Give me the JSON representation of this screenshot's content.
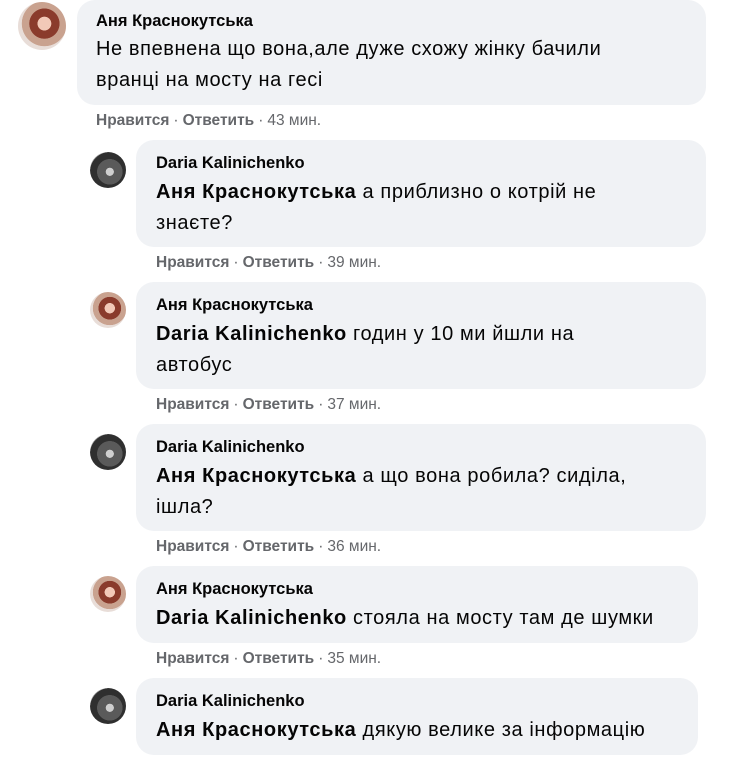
{
  "comments": [
    {
      "author": "Аня Краснокутська",
      "avatar": "aya",
      "mention": "",
      "text": "Не впевнена що вона,але дуже схожу жінку бачили вранці на мосту на гесі",
      "line1": "Не впевнена що вона,але дуже схожу жінку бачили",
      "line2": "вранці на мосту на гесі",
      "like": "Нравится",
      "reply": "Ответить",
      "time": "43 мин."
    },
    {
      "author": "Daria Kalinichenko",
      "avatar": "daria",
      "mention": "Аня Краснокутська",
      "line1": " а приблизно о котрій не",
      "line2": "знаєте?",
      "like": "Нравится",
      "reply": "Ответить",
      "time": "39 мин."
    },
    {
      "author": "Аня Краснокутська",
      "avatar": "aya",
      "mention": "Daria Kalinichenko",
      "line1": " годин у 10 ми йшли на",
      "line2": "автобус",
      "like": "Нравится",
      "reply": "Ответить",
      "time": "37 мин."
    },
    {
      "author": "Daria Kalinichenko",
      "avatar": "daria",
      "mention": "Аня Краснокутська",
      "line1": " а що вона робила? сиділа,",
      "line2": "ішла?",
      "like": "Нравится",
      "reply": "Ответить",
      "time": "36 мин."
    },
    {
      "author": "Аня Краснокутська",
      "avatar": "aya",
      "mention": "Daria Kalinichenko",
      "line1": " стояла на мосту там де шумки",
      "line2": "",
      "like": "Нравится",
      "reply": "Ответить",
      "time": "35 мин."
    },
    {
      "author": "Daria Kalinichenko",
      "avatar": "daria",
      "mention": "Аня Краснокутська",
      "line1": " дякую велике за інформацію",
      "line2": "",
      "like": "",
      "reply": "",
      "time": ""
    }
  ]
}
